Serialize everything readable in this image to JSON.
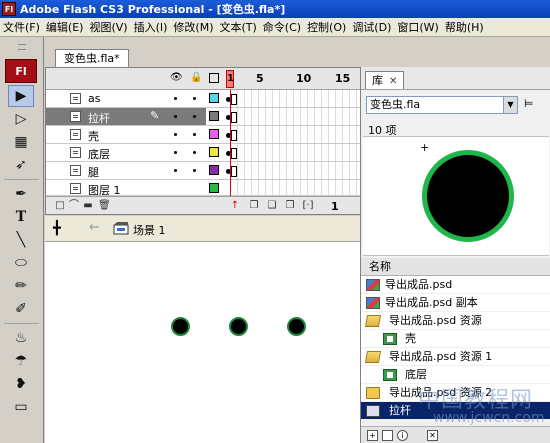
{
  "window": {
    "title": "Adobe Flash CS3 Professional - [变色虫.fla*]",
    "app_icon": "Fl"
  },
  "menu": [
    "文件(F)",
    "编辑(E)",
    "视图(V)",
    "插入(I)",
    "修改(M)",
    "文本(T)",
    "命令(C)",
    "控制(O)",
    "调试(D)",
    "窗口(W)",
    "帮助(H)"
  ],
  "toolbar": {
    "logo": "Fl"
  },
  "document_tab": "变色虫.fla*",
  "timeline": {
    "frame_numbers": [
      "1",
      "5",
      "10",
      "15"
    ],
    "layers": [
      {
        "name": "as",
        "color": "#4fd8e8"
      },
      {
        "name": "拉杆",
        "color": "#7a7a7a",
        "selected": true
      },
      {
        "name": "壳",
        "color": "#e85cf0"
      },
      {
        "name": "底层",
        "color": "#f0e640"
      },
      {
        "name": "腿",
        "color": "#8a2aa8"
      },
      {
        "name": "图层 1",
        "color": "#2ab84a"
      }
    ],
    "current_frame": "1"
  },
  "editbar": {
    "scene": "场景 1"
  },
  "library": {
    "tab": "库",
    "document": "变色虫.fla",
    "count": "10 项",
    "column_header": "名称",
    "items": [
      {
        "name": "导出成品.psd",
        "icon": "bitmap-icon",
        "indent": 0
      },
      {
        "name": "导出成品.psd 副本",
        "icon": "bitmap-icon",
        "indent": 0
      },
      {
        "name": "导出成品.psd 资源",
        "icon": "folder-open-icon",
        "indent": 0
      },
      {
        "name": "壳",
        "icon": "graphic-icon",
        "indent": 1
      },
      {
        "name": "导出成品.psd 资源 1",
        "icon": "folder-open-icon",
        "indent": 0
      },
      {
        "name": "底层",
        "icon": "graphic-icon",
        "indent": 1
      },
      {
        "name": "导出成品.psd 资源 2",
        "icon": "folder-icon",
        "indent": 0
      },
      {
        "name": "拉杆",
        "icon": "movieclip-icon",
        "indent": 0,
        "selected": true
      }
    ]
  },
  "watermark": {
    "line1": "中国教程网",
    "line2": "www.jcwcn.com"
  }
}
